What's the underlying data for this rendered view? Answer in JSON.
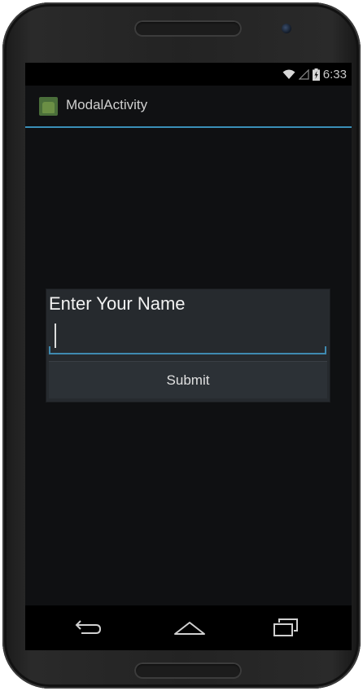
{
  "status_bar": {
    "time": "6:33",
    "icons": [
      "wifi-icon",
      "signal-icon",
      "battery-charging-icon"
    ]
  },
  "action_bar": {
    "app_icon": "android-app-icon",
    "title": "ModalActivity"
  },
  "dialog": {
    "title": "Enter Your Name",
    "input_value": "",
    "input_placeholder": "",
    "submit_label": "Submit"
  },
  "nav_bar": {
    "buttons": [
      "back-icon",
      "home-icon",
      "recent-apps-icon"
    ]
  },
  "colors": {
    "accent": "#3f8ab0",
    "screen_background": "#0f1012",
    "dialog_background": "#262a2e"
  }
}
